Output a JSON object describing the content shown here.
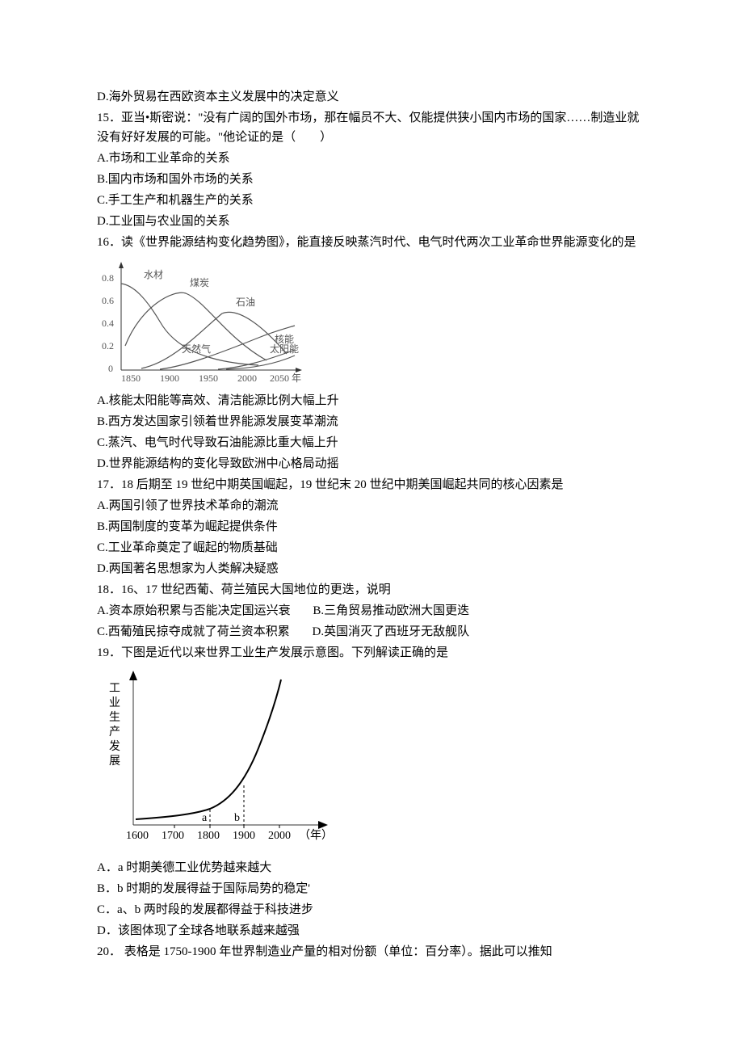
{
  "q14": {
    "optD": "D.海外贸易在西欧资本主义发展中的决定意义"
  },
  "q15": {
    "stem": "15．亚当•斯密说：\"没有广阔的国外市场，那在幅员不大、仅能提供狭小国内市场的国家……制造业就没有好好发展的可能。\"他论证的是（　　）",
    "A": "A.市场和工业革命的关系",
    "B": "B.国内市场和国外市场的关系",
    "C": "C.手工生产和机器生产的关系",
    "D": "D.工业国与农业国的关系"
  },
  "q16": {
    "stem": "16．读《世界能源结构变化趋势图》，能直接反映蒸汽时代、电气时代两次工业革命世界能源变化的是",
    "A": "A.核能太阳能等高效、清洁能源比例大幅上升",
    "B": "B.西方发达国家引领着世界能源发展变革潮流",
    "C": "C.蒸汽、电气时代导致石油能源比重大幅上升",
    "D": "D.世界能源结构的变化导致欧洲中心格局动摇"
  },
  "q17": {
    "stem": "17．18 后期至 19 世纪中期英国崛起，19 世纪末 20 世纪中期美国崛起共同的核心因素是",
    "A": "A.两国引领了世界技术革命的潮流",
    "B": "B.两国制度的变革为崛起提供条件",
    "C": "C.工业革命奠定了崛起的物质基础",
    "D": "D.两国著名思想家为人类解决疑惑"
  },
  "q18": {
    "stem": "18．16、17 世纪西葡、荷兰殖民大国地位的更迭，说明",
    "A": "A.资本原始积累与否能决定国运兴衰",
    "B": "B.三角贸易推动欧洲大国更迭",
    "C": "C.西葡殖民掠夺成就了荷兰资本积累",
    "D": "D.英国消灭了西班牙无敌舰队"
  },
  "q19": {
    "stem": "19．下图是近代以来世界工业生产发展示意图。下列解读正确的是",
    "A": "A．a 时期美德工业优势越来越大",
    "B": "B．b 时期的发展得益于国际局势的稳定'",
    "C": "C．a、b 两时段的发展都得益于科技进步",
    "D": "D．该图体现了全球各地联系越来越强"
  },
  "q20": {
    "stem": "20．  表格是 1750-1900 年世界制造业产量的相对份额（单位：百分率）。据此可以推知"
  },
  "chart_data": [
    {
      "type": "line",
      "title": "世界能源结构变化趋势图",
      "xlabel": "年",
      "ylabel": "",
      "xlim": [
        1850,
        2050
      ],
      "ylim": [
        0,
        0.8
      ],
      "x_ticks": [
        1850,
        1900,
        1950,
        2000,
        2050
      ],
      "y_ticks": [
        0,
        0.2,
        0.4,
        0.6,
        0.8
      ],
      "series": [
        {
          "name": "水材",
          "x": [
            1850,
            1870,
            1900,
            1950,
            2000,
            2050
          ],
          "values": [
            0.72,
            0.68,
            0.4,
            0.12,
            0.05,
            0.05
          ]
        },
        {
          "name": "煤炭",
          "x": [
            1850,
            1900,
            1930,
            1960,
            2000,
            2050
          ],
          "values": [
            0.2,
            0.55,
            0.62,
            0.4,
            0.2,
            0.1
          ]
        },
        {
          "name": "石油",
          "x": [
            1870,
            1920,
            1970,
            2010,
            2050
          ],
          "values": [
            0.0,
            0.1,
            0.45,
            0.4,
            0.2
          ]
        },
        {
          "name": "天然气",
          "x": [
            1900,
            1950,
            2000,
            2050
          ],
          "values": [
            0.0,
            0.1,
            0.25,
            0.3
          ]
        },
        {
          "name": "核能",
          "x": [
            1960,
            2000,
            2050
          ],
          "values": [
            0.0,
            0.05,
            0.15
          ]
        },
        {
          "name": "太阳能",
          "x": [
            1970,
            2000,
            2050
          ],
          "values": [
            0.0,
            0.03,
            0.12
          ]
        }
      ],
      "labels": {
        "水材": "水材",
        "煤炭": "煤炭",
        "石油": "石油",
        "天然气": "天然气",
        "核能": "核能",
        "太阳能": "太阳能",
        "x_unit": "年"
      }
    },
    {
      "type": "line",
      "title": "近代以来世界工业生产发展示意图",
      "xlabel": "（年）",
      "ylabel": "工业生产发展",
      "xlim": [
        1600,
        2000
      ],
      "ylim": [
        0,
        100
      ],
      "x_ticks": [
        1600,
        1700,
        1800,
        1900,
        2000
      ],
      "markers": {
        "a": 1800,
        "b": 1900
      },
      "series": [
        {
          "name": "工业生产发展",
          "x": [
            1600,
            1700,
            1800,
            1850,
            1900,
            1950,
            2000
          ],
          "values": [
            3,
            5,
            8,
            15,
            30,
            60,
            100
          ]
        }
      ]
    }
  ]
}
